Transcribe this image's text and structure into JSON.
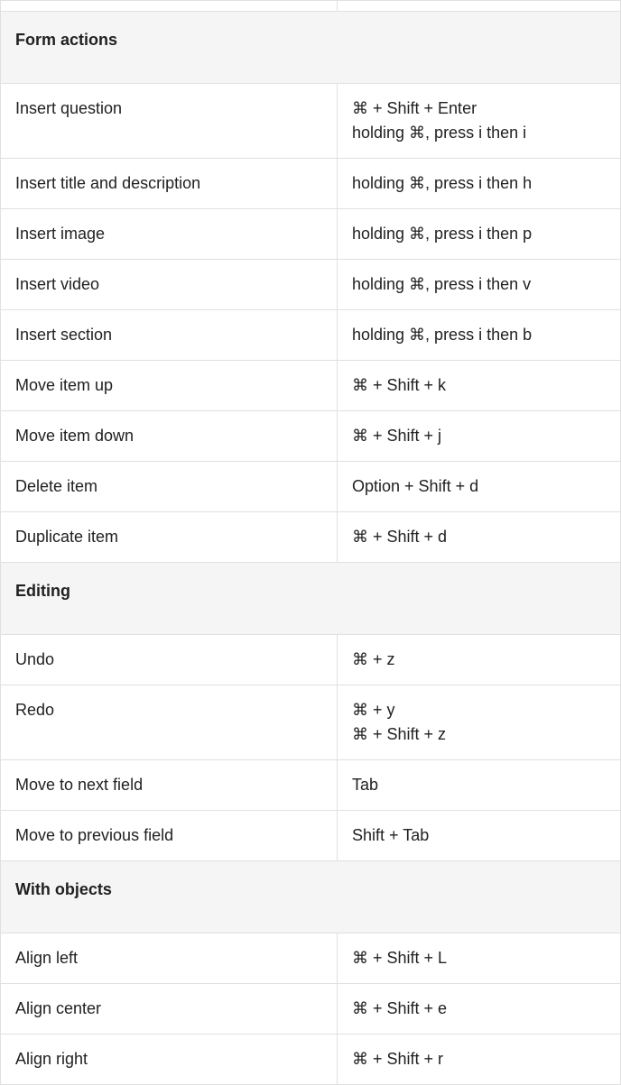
{
  "sections": [
    {
      "title": "Form actions",
      "rows": [
        {
          "action": "Insert question",
          "shortcuts": [
            "⌘ + Shift + Enter",
            "holding ⌘, press i then i"
          ]
        },
        {
          "action": "Insert title and description",
          "shortcuts": [
            "holding ⌘, press i then h"
          ]
        },
        {
          "action": "Insert image",
          "shortcuts": [
            "holding ⌘, press i then p"
          ]
        },
        {
          "action": "Insert video",
          "shortcuts": [
            "holding ⌘, press i then v"
          ]
        },
        {
          "action": "Insert section",
          "shortcuts": [
            "holding ⌘, press i then b"
          ]
        },
        {
          "action": "Move item up",
          "shortcuts": [
            "⌘ + Shift + k"
          ]
        },
        {
          "action": "Move item down",
          "shortcuts": [
            "⌘ + Shift + j"
          ]
        },
        {
          "action": "Delete item",
          "shortcuts": [
            "Option + Shift + d"
          ]
        },
        {
          "action": "Duplicate item",
          "shortcuts": [
            "⌘ + Shift + d"
          ]
        }
      ]
    },
    {
      "title": "Editing",
      "rows": [
        {
          "action": "Undo",
          "shortcuts": [
            "⌘ + z"
          ]
        },
        {
          "action": "Redo",
          "shortcuts": [
            "⌘ + y",
            "⌘ + Shift + z"
          ]
        },
        {
          "action": "Move to next field",
          "shortcuts": [
            "Tab"
          ]
        },
        {
          "action": "Move to previous field",
          "shortcuts": [
            "Shift + Tab"
          ]
        }
      ]
    },
    {
      "title": "With objects",
      "rows": [
        {
          "action": "Align left",
          "shortcuts": [
            "⌘ + Shift + L"
          ]
        },
        {
          "action": "Align center",
          "shortcuts": [
            "⌘ + Shift + e"
          ]
        },
        {
          "action": "Align right",
          "shortcuts": [
            "⌘ + Shift + r"
          ]
        }
      ]
    }
  ]
}
